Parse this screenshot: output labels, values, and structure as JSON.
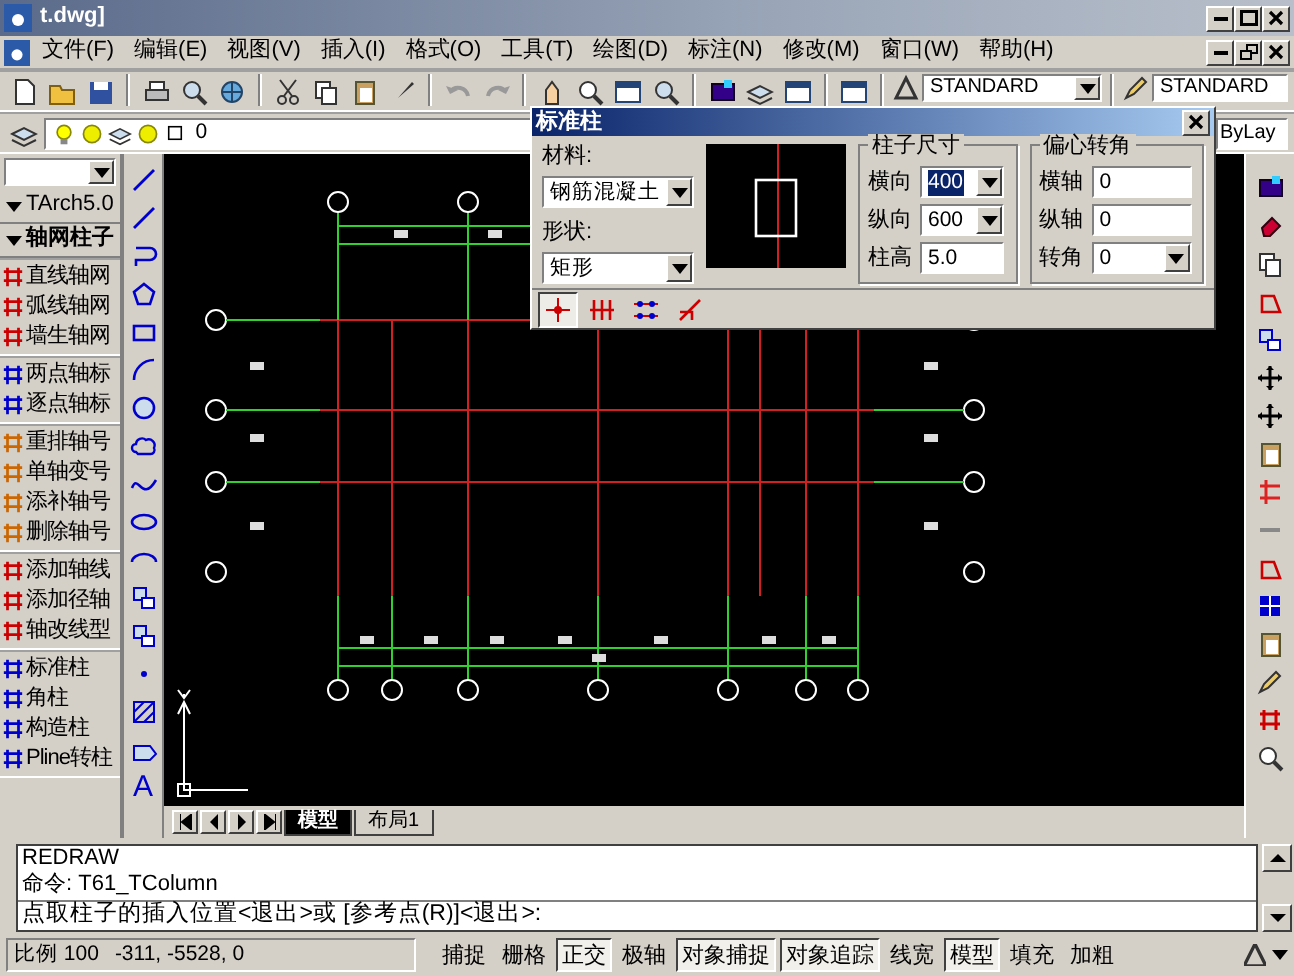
{
  "window": {
    "title": "t.dwg]"
  },
  "menu": [
    "文件(F)",
    "编辑(E)",
    "视图(V)",
    "插入(I)",
    "格式(O)",
    "工具(T)",
    "绘图(D)",
    "标注(N)",
    "修改(M)",
    "窗口(W)",
    "帮助(H)"
  ],
  "toolbar": {
    "text_style": "STANDARD",
    "dim_style": "STANDARD"
  },
  "layer_bar": {
    "layer": "0",
    "linetype": "ByLay"
  },
  "palette": {
    "title": "TArch5.0",
    "section": "轴网柱子",
    "groups": [
      [
        {
          "label": "直线轴网"
        },
        {
          "label": "弧线轴网"
        },
        {
          "label": "墙生轴网"
        }
      ],
      [
        {
          "label": "两点轴标"
        },
        {
          "label": "逐点轴标"
        }
      ],
      [
        {
          "label": "重排轴号"
        },
        {
          "label": "单轴变号"
        },
        {
          "label": "添补轴号"
        },
        {
          "label": "删除轴号"
        }
      ],
      [
        {
          "label": "添加轴线"
        },
        {
          "label": "添加径轴"
        },
        {
          "label": "轴改线型"
        }
      ],
      [
        {
          "label": "标准柱"
        },
        {
          "label": "角柱"
        },
        {
          "label": "构造柱"
        },
        {
          "label": "Pline转柱"
        }
      ]
    ]
  },
  "draw_toolbar": {
    "text_tool": "A"
  },
  "dialog": {
    "title": "标准柱",
    "material_label": "材料:",
    "material": "钢筋混凝土",
    "shape_label": "形状:",
    "shape": "矩形",
    "size_group": "柱子尺寸",
    "size_fields": [
      {
        "label": "横向",
        "value": "400",
        "kind": "combo",
        "selected": true
      },
      {
        "label": "纵向",
        "value": "600",
        "kind": "combo",
        "selected": false
      },
      {
        "label": "柱高",
        "value": "5.0",
        "kind": "text",
        "selected": false
      }
    ],
    "offset_group": "偏心转角",
    "offset_fields": [
      {
        "label": "横轴",
        "value": "0",
        "kind": "text"
      },
      {
        "label": "纵轴",
        "value": "0",
        "kind": "text"
      },
      {
        "label": "转角",
        "value": "0",
        "kind": "combo"
      }
    ],
    "modes": [
      {
        "selected": true
      },
      {
        "selected": false
      },
      {
        "selected": false
      },
      {
        "selected": false
      }
    ]
  },
  "tabs": [
    {
      "label": "模型",
      "selected": true
    },
    {
      "label": "布局1",
      "selected": false
    }
  ],
  "command": {
    "history": [
      "REDRAW",
      "命令: T61_TColumn"
    ],
    "prompt": "点取柱子的插入位置<退出>或 [参考点(R)]<退出>:"
  },
  "status_bar": {
    "scale": "比例 100",
    "coordinates": "-311, -5528, 0",
    "toggles": [
      {
        "label": "捕捉",
        "on": false
      },
      {
        "label": "栅格",
        "on": false
      },
      {
        "label": "正交",
        "on": true
      },
      {
        "label": "极轴",
        "on": false
      },
      {
        "label": "对象捕捉",
        "on": true
      },
      {
        "label": "对象追踪",
        "on": true
      },
      {
        "label": "线宽",
        "on": false
      },
      {
        "label": "模型",
        "on": true
      },
      {
        "label": "填充",
        "on": false
      },
      {
        "label": "加粗",
        "on": false
      }
    ]
  }
}
